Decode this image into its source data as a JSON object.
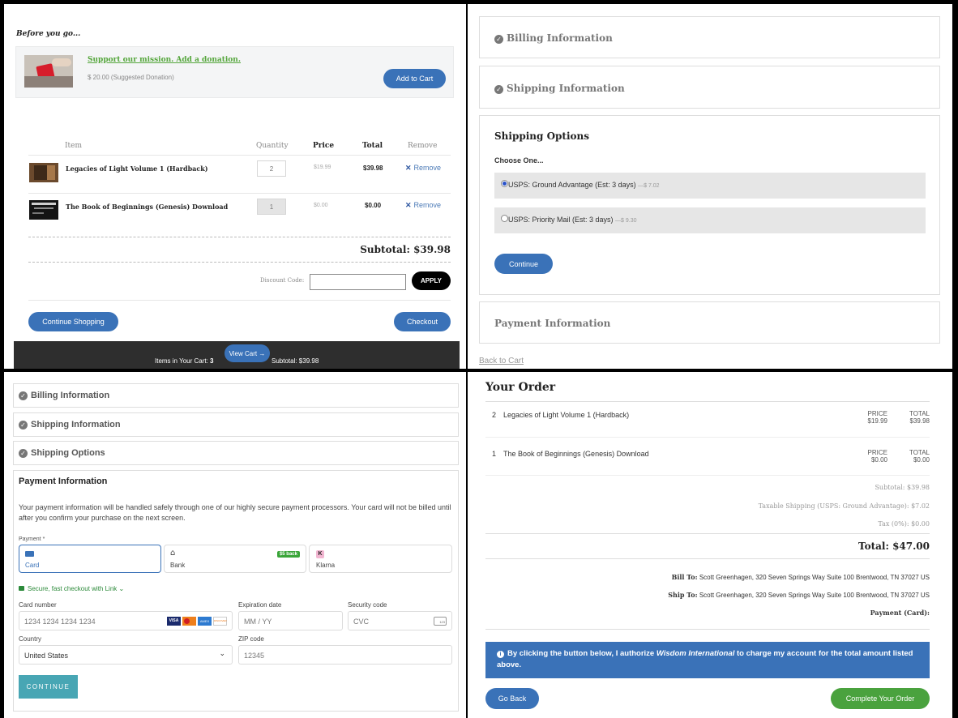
{
  "cart": {
    "before_heading": "Before you go...",
    "donation": {
      "link": "Support our mission. Add a donation.",
      "price": "$ 20.00 (Suggested Donation)",
      "add_label": "Add to Cart"
    },
    "columns": {
      "item": "Item",
      "quantity": "Quantity",
      "price": "Price",
      "total": "Total",
      "remove": "Remove"
    },
    "items": [
      {
        "name": "Legacies of Light Volume 1 (Hardback)",
        "qty": "2",
        "price": "$19.99",
        "total": "$39.98",
        "remove": "Remove"
      },
      {
        "name": "The Book of Beginnings (Genesis) Download",
        "qty": "1",
        "price": "$0.00",
        "total": "$0.00",
        "remove": "Remove"
      }
    ],
    "subtotal": "Subtotal: $39.98",
    "discount_label": "Discount Code:",
    "discount_value": "",
    "apply_label": "APPLY",
    "continue_label": "Continue Shopping",
    "checkout_label": "Checkout",
    "footer": {
      "view_cart": "View Cart →",
      "items_label": "Items in Your Cart:",
      "items_count": "3",
      "subtotal": "Subtotal: $39.98"
    }
  },
  "shipping": {
    "billing_title": "Billing Information",
    "shipping_title": "Shipping Information",
    "options_title": "Shipping Options",
    "choose": "Choose One...",
    "options": [
      {
        "label": "USPS: Ground Advantage (Est: 3 days)",
        "price": "—$ 7.02",
        "selected": true
      },
      {
        "label": "USPS: Priority Mail (Est: 3 days)",
        "price": "—$ 9.30",
        "selected": false
      }
    ],
    "continue_label": "Continue",
    "payment_title": "Payment Information",
    "back_link": "Back to Cart"
  },
  "payment": {
    "billing_title": "Billing Information",
    "shipping_title": "Shipping Information",
    "options_title": "Shipping Options",
    "payment_title": "Payment Information",
    "notice": "Your payment information will be handled safely through one of our highly secure payment processors. Your card will not be billed until after you confirm your purchase on the next screen.",
    "method_label": "Payment *",
    "tabs": {
      "card": "Card",
      "bank": "Bank",
      "bank_badge": "$5 back",
      "klarna": "Klarna"
    },
    "link_text": "Secure, fast checkout with Link",
    "card_number_label": "Card number",
    "card_number_placeholder": "1234 1234 1234 1234",
    "expiry_label": "Expiration date",
    "expiry_placeholder": "MM / YY",
    "cvc_label": "Security code",
    "cvc_placeholder": "CVC",
    "country_label": "Country",
    "country_value": "United States",
    "zip_label": "ZIP code",
    "zip_placeholder": "12345",
    "card_brands": [
      "VISA",
      "MC",
      "AMEX",
      "DISCOVER"
    ],
    "cvc_card_number": "123",
    "continue_label": "CONTINUE"
  },
  "order": {
    "title": "Your Order",
    "items": [
      {
        "qty": "2",
        "name": "Legacies of Light Volume 1 (Hardback)",
        "price_label": "PRICE",
        "price": "$19.99",
        "total_label": "TOTAL",
        "total": "$39.98"
      },
      {
        "qty": "1",
        "name": "The Book of Beginnings (Genesis) Download",
        "price_label": "PRICE",
        "price": "$0.00",
        "total_label": "TOTAL",
        "total": "$0.00"
      }
    ],
    "subtotal": "Subtotal: $39.98",
    "shipping": "Taxable Shipping (USPS: Ground Advantage): $7.02",
    "tax": "Tax (0%): $0.00",
    "total": "Total: $47.00",
    "bill_to_label": "Bill To:",
    "bill_to": "Scott Greenhagen, 320 Seven Springs Way Suite 100 Brentwood, TN 37027 US",
    "ship_to_label": "Ship To:",
    "ship_to": "Scott Greenhagen, 320 Seven Springs Way Suite 100 Brentwood, TN 37027 US",
    "payment_label": "Payment (Card):",
    "auth_pre": "By clicking the button below, I authorize ",
    "auth_company": "Wisdom International",
    "auth_post": " to charge my account for the total amount listed above.",
    "go_back_label": "Go Back",
    "complete_label": "Complete Your Order"
  },
  "colors": {
    "blue": "#3a72b8",
    "green": "#4aa23e",
    "teal": "#48a6b4",
    "dark_bar": "#2e2e2e"
  }
}
